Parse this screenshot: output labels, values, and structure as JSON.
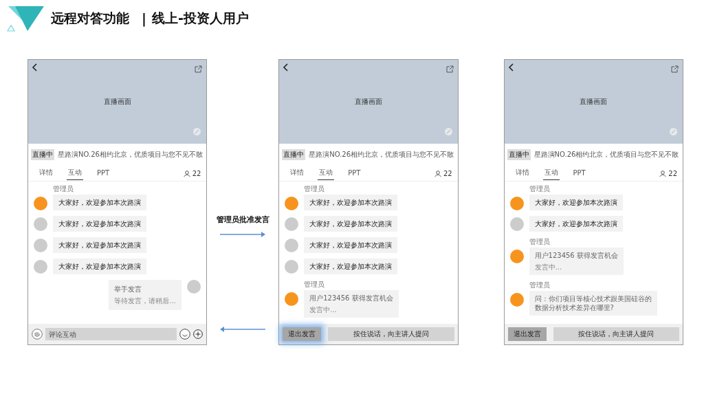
{
  "title": {
    "main": "远程对答功能",
    "divider": "|",
    "sub": "线上-投资人用户"
  },
  "phones": [
    {
      "video_label": "直播画面",
      "live_badge": "直播中",
      "headline": "星路演NO.26相约北京，优质项目与您不见不散",
      "tabs": [
        {
          "label": "详情",
          "selected": false
        },
        {
          "label": "互动",
          "selected": true
        },
        {
          "label": "PPT",
          "selected": false
        }
      ],
      "viewer_count": "22",
      "messages": [
        {
          "kind": "chat",
          "color": "#f7941d",
          "author": "管理员",
          "lines": [
            "大家好，欢迎参加本次路演"
          ]
        },
        {
          "kind": "chat",
          "color": "#cccccc",
          "lines": [
            "大家好，欢迎参加本次路演"
          ]
        },
        {
          "kind": "chat",
          "color": "#cccccc",
          "lines": [
            "大家好，欢迎参加本次路演"
          ]
        },
        {
          "kind": "chat",
          "color": "#cccccc",
          "lines": [
            "大家好，欢迎参加本次路演"
          ]
        },
        {
          "outgoing": true,
          "kind": "notice",
          "color": "#cccccc",
          "lines": [
            "举手发言",
            "等待发言，请稍后..."
          ]
        }
      ],
      "bottom": {
        "kind": "comment",
        "placeholder": "评论互动"
      }
    },
    {
      "video_label": "直播画面",
      "live_badge": "直播中",
      "headline": "星路演NO.26相约北京，优质项目与您不见不散",
      "tabs": [
        {
          "label": "详情",
          "selected": false
        },
        {
          "label": "互动",
          "selected": true
        },
        {
          "label": "PPT",
          "selected": false
        }
      ],
      "viewer_count": "22",
      "messages": [
        {
          "kind": "chat",
          "color": "#f7941d",
          "author": "管理员",
          "lines": [
            "大家好，欢迎参加本次路演"
          ]
        },
        {
          "kind": "chat",
          "color": "#cccccc",
          "lines": [
            "大家好，欢迎参加本次路演"
          ]
        },
        {
          "kind": "chat",
          "color": "#cccccc",
          "lines": [
            "大家好，欢迎参加本次路演"
          ]
        },
        {
          "kind": "chat",
          "color": "#cccccc",
          "lines": [
            "大家好，欢迎参加本次路演"
          ]
        },
        {
          "kind": "notice",
          "color": "#f7941d",
          "author": "管理员",
          "lines": [
            "用户123456 获得发言机会",
            "发言中..."
          ]
        }
      ],
      "bottom": {
        "kind": "speaking",
        "exit_button": "退出发言",
        "exit_highlighted": true,
        "talk_button": "按住说话，向主讲人提问"
      }
    },
    {
      "video_label": "直播画面",
      "live_badge": "直播中",
      "headline": "星路演NO.26相约北京，优质项目与您不见不散",
      "tabs": [
        {
          "label": "详情",
          "selected": false
        },
        {
          "label": "互动",
          "selected": true
        },
        {
          "label": "PPT",
          "selected": false
        }
      ],
      "viewer_count": "22",
      "messages": [
        {
          "kind": "chat",
          "color": "#f7941d",
          "author": "管理员",
          "lines": [
            "大家好，欢迎参加本次路演"
          ]
        },
        {
          "kind": "chat",
          "color": "#cccccc",
          "lines": [
            "大家好，欢迎参加本次路演"
          ]
        },
        {
          "kind": "notice",
          "color": "#f7941d",
          "author": "管理员",
          "lines": [
            "用户123456 获得发言机会",
            "发言中..."
          ]
        },
        {
          "kind": "notice",
          "color": "#f7941d",
          "author": "管理员",
          "lines": [
            "问：你们项目等核心技术跟美国硅谷的数据分析技术差异在哪里?"
          ]
        }
      ],
      "bottom": {
        "kind": "speaking",
        "exit_button": "退出发言",
        "exit_highlighted": false,
        "talk_button": "按住说话，向主讲人提问"
      }
    }
  ],
  "arrows": [
    {
      "kind": "forward",
      "label": "管理员批准发言"
    },
    {
      "kind": "back"
    }
  ]
}
